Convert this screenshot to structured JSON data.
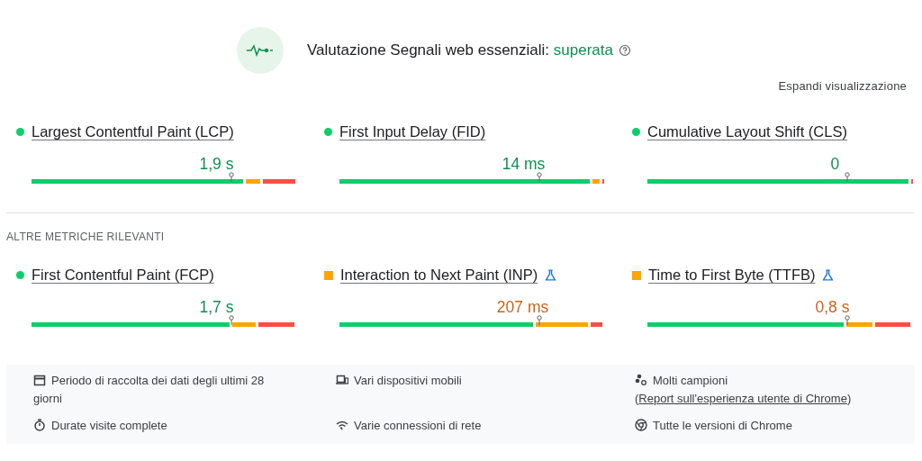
{
  "assessment": {
    "label": "Valutazione Segnali web essenziali:",
    "result": "superata",
    "passed": true
  },
  "expand_link": "Espandi visualizzazione",
  "core_metrics": [
    {
      "name": "Largest Contentful Paint (LCP)",
      "kind": "good",
      "experimental": false,
      "value": "1,9 s"
    },
    {
      "name": "First Input Delay (FID)",
      "kind": "good",
      "experimental": false,
      "value": "14 ms"
    },
    {
      "name": "Cumulative Layout Shift (CLS)",
      "kind": "good",
      "experimental": false,
      "value": "0"
    }
  ],
  "other_section_title": "ALTRE METRICHE RILEVANTI",
  "other_metrics": [
    {
      "name": "First Contentful Paint (FCP)",
      "kind": "good",
      "experimental": false,
      "value": "1,7 s"
    },
    {
      "name": "Interaction to Next Paint (INP)",
      "kind": "average",
      "experimental": true,
      "value": "207 ms"
    },
    {
      "name": "Time to First Byte (TTFB)",
      "kind": "average",
      "experimental": true,
      "value": "0,8 s"
    }
  ],
  "details": [
    {
      "kind": "calendar",
      "text": "Periodo di raccolta dei dati degli ultimi 28 giorni"
    },
    {
      "kind": "devices",
      "text": "Vari dispositivi mobili"
    },
    {
      "kind": "samples",
      "text": "Molti campioni (",
      "link": "Report sull'esperienza utente di Chrome",
      "suffix": ")"
    },
    {
      "kind": "timer",
      "text": "Durate visite complete"
    },
    {
      "kind": "network",
      "text": "Varie connessioni di rete"
    },
    {
      "kind": "chrome",
      "text": "Tutte le versioni di Chrome"
    }
  ]
}
